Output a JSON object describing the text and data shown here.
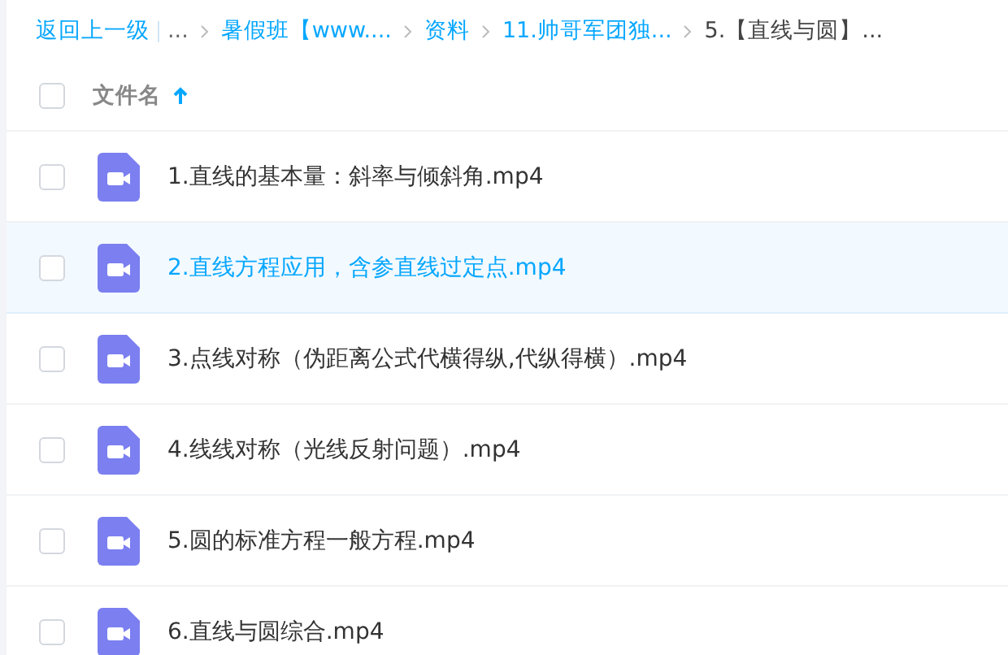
{
  "breadcrumb": {
    "back": "返回上一级",
    "items": [
      {
        "label": "...",
        "kind": "ellipsis"
      },
      {
        "label": "暑假班【www....",
        "kind": "link"
      },
      {
        "label": "资料",
        "kind": "link"
      },
      {
        "label": "11.帅哥军团独...",
        "kind": "link"
      },
      {
        "label": "5.【直线与圆】...",
        "kind": "current"
      }
    ]
  },
  "header": {
    "checked": false,
    "column": "文件名",
    "sort_ascending": true
  },
  "files": [
    {
      "name": "1.直线的基本量：斜率与倾斜角.mp4",
      "checked": false,
      "hovered": false
    },
    {
      "name": "2.直线方程应用，含参直线过定点.mp4",
      "checked": false,
      "hovered": true
    },
    {
      "name": "3.点线对称（伪距离公式代横得纵,代纵得横）.mp4",
      "checked": false,
      "hovered": false
    },
    {
      "name": "4.线线对称（光线反射问题）.mp4",
      "checked": false,
      "hovered": false
    },
    {
      "name": "5.圆的标准方程一般方程.mp4",
      "checked": false,
      "hovered": false
    },
    {
      "name": "6.直线与圆综合.mp4",
      "checked": false,
      "hovered": false
    }
  ]
}
